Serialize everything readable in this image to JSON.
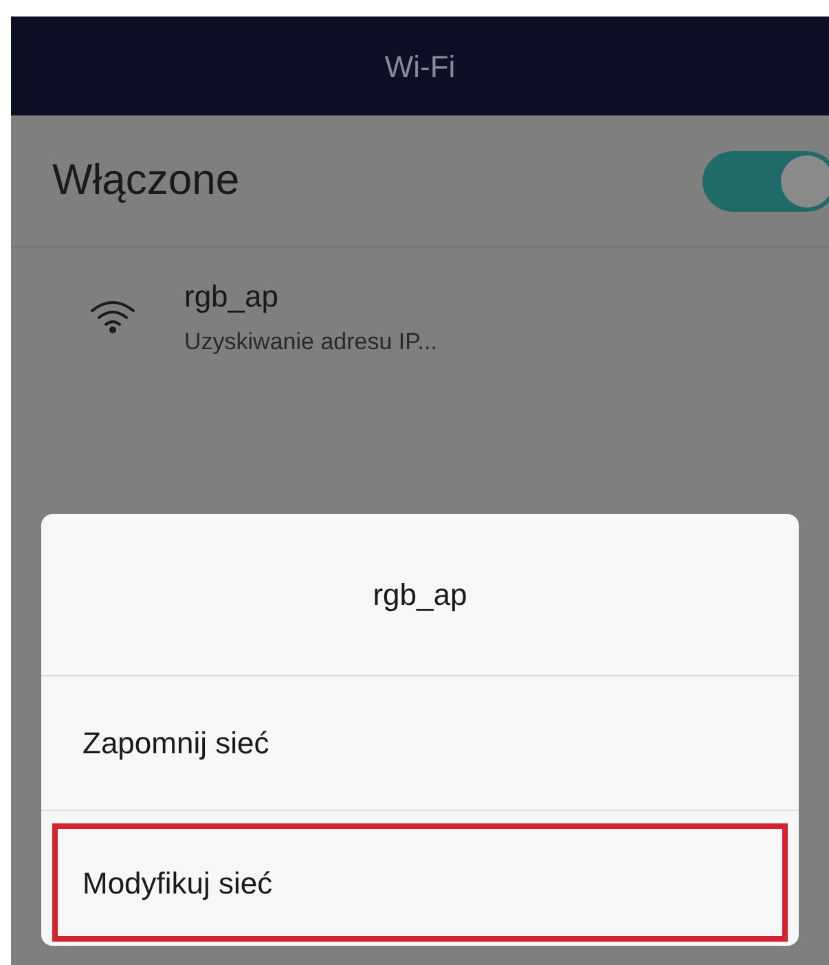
{
  "header": {
    "title": "Wi-Fi"
  },
  "wifi_switch": {
    "label": "Włączone",
    "on": true
  },
  "networks": [
    {
      "name": "rgb_ap",
      "status": "Uzyskiwanie adresu IP..."
    }
  ],
  "dialog": {
    "title": "rgb_ap",
    "items": [
      {
        "label": "Zapomnij sieć",
        "highlighted": false
      },
      {
        "label": "Modyfikuj sieć",
        "highlighted": true
      }
    ]
  }
}
